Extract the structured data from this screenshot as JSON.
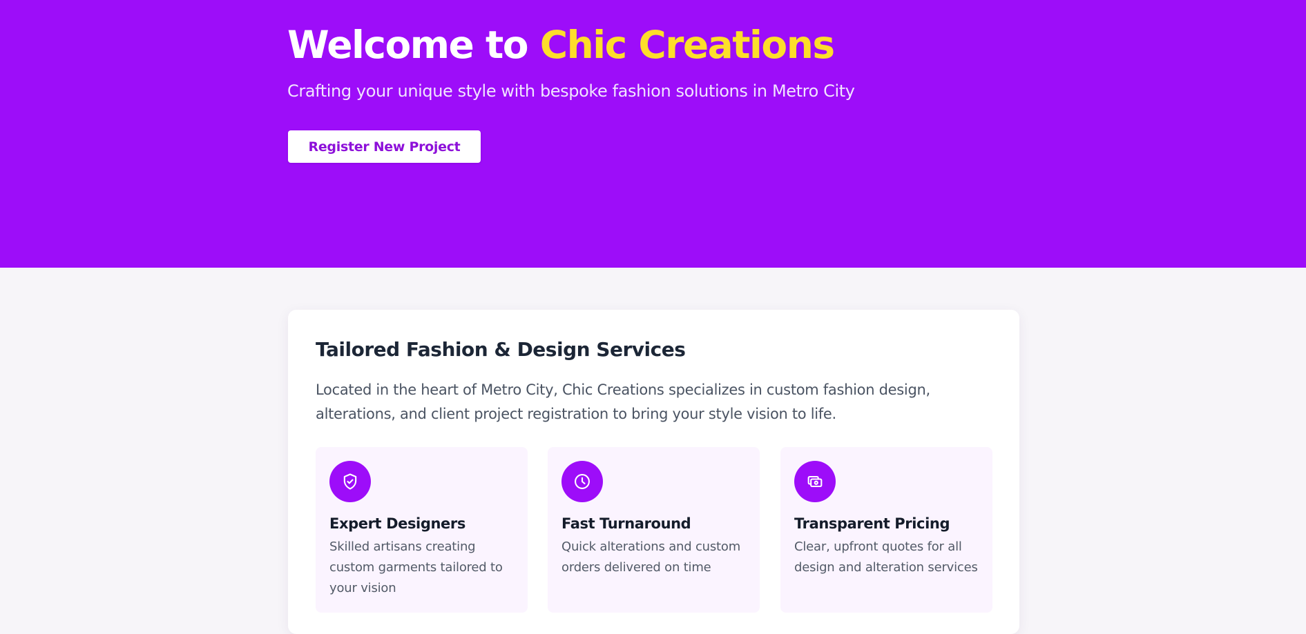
{
  "hero": {
    "title_prefix": "Welcome to ",
    "title_accent": "Chic Creations",
    "subtitle": "Crafting your unique style with bespoke fashion solutions in Metro City",
    "cta_label": "Register New Project",
    "colors": {
      "background": "#9d0df9",
      "accent": "#fdde2a",
      "button_text": "#8d10d9"
    }
  },
  "services": {
    "title": "Tailored Fashion & Design Services",
    "description": "Located in the heart of Metro City, Chic Creations specializes in custom fashion design, alterations, and client project registration to bring your style vision to life.",
    "features": [
      {
        "icon": "shield-check-icon",
        "title": "Expert Designers",
        "description": "Skilled artisans creating custom garments tailored to your vision"
      },
      {
        "icon": "clock-icon",
        "title": "Fast Turnaround",
        "description": "Quick alterations and custom orders delivered on time"
      },
      {
        "icon": "cash-icon",
        "title": "Transparent Pricing",
        "description": "Clear, upfront quotes for all design and alteration services"
      }
    ]
  }
}
